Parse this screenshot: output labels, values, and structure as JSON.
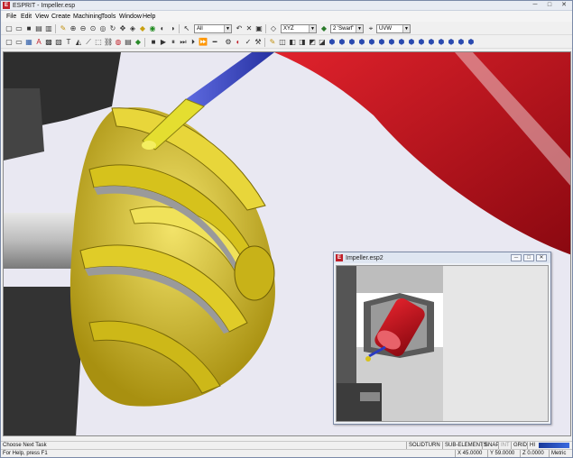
{
  "window": {
    "icon_letter": "E",
    "title": "ESPRIT - Impeller.esp",
    "controls": {
      "minimize": "─",
      "maximize": "□",
      "close": "✕"
    }
  },
  "menu": [
    "File",
    "Edit",
    "View",
    "Create",
    "Machining",
    "Tools",
    "Window",
    "Help"
  ],
  "toolbar": {
    "layer_combo": "All",
    "plane_combo": "XYZ",
    "operation_combo": "2 'Swarf'",
    "coord_combo": "UVW"
  },
  "child_window": {
    "icon_letter": "E",
    "title": "Impeller.esp2",
    "controls": {
      "minimize": "─",
      "maximize": "□",
      "close": "✕"
    }
  },
  "status": {
    "task": "Choose Next Task",
    "help": "For Help, press F1",
    "panels": [
      "SOLIDTURN",
      "SUB-ELEMENTS",
      "SNAP",
      "INT",
      "GRID",
      "HI"
    ],
    "x": "X 45.0000",
    "y": "Y 59.0000",
    "z": "Z 0.0000",
    "units": "Metric"
  },
  "colors": {
    "impeller": "#d8c21a",
    "blade_highlight": "#f2e66a",
    "tool_blue": "#3a49c9",
    "tool_tip": "#e2dc2e",
    "red_part": "#c4121e",
    "shaft": "#bcbcbc",
    "machine_dark": "#3a3a3a",
    "background": "#e9e8f2"
  }
}
